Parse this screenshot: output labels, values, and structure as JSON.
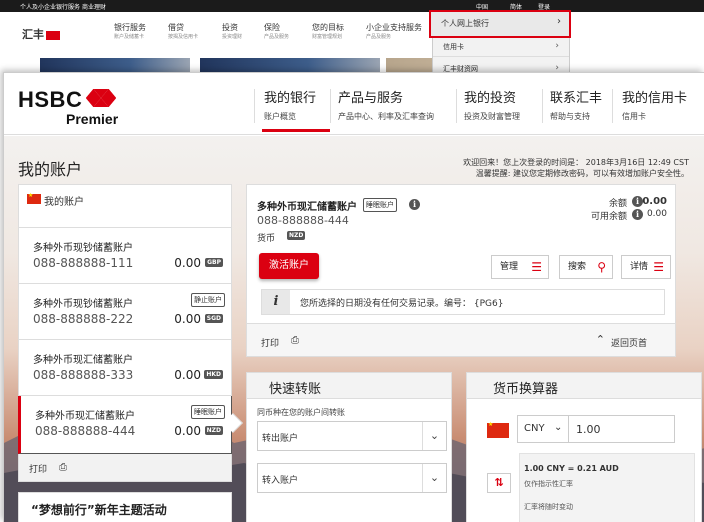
{
  "bg_site": {
    "top_links": [
      "个人及小企业银行服务",
      "商业理财"
    ],
    "top_right": [
      "中国",
      "简体",
      "登录"
    ],
    "logo_text": "汇丰",
    "nav": [
      {
        "title": "银行服务",
        "sub": "账户及储蓄卡"
      },
      {
        "title": "借贷",
        "sub": "按揭及信用卡"
      },
      {
        "title": "投资",
        "sub": "投资理财"
      },
      {
        "title": "保险",
        "sub": "产品及服务"
      },
      {
        "title": "您的目标",
        "sub": "财富管理规划"
      },
      {
        "title": "小企业支持服务",
        "sub": "产品及服务"
      }
    ],
    "dropdown": [
      "个人网上银行",
      "信用卡",
      "汇丰财资网"
    ]
  },
  "header": {
    "logo_word": "HSBC",
    "logo_sub": "Premier",
    "nav": [
      {
        "title": "我的银行",
        "sub": "账户概览"
      },
      {
        "title": "产品与服务",
        "sub": "产品中心、利率及汇率查询"
      },
      {
        "title": "我的投资",
        "sub": "投资及财富管理"
      },
      {
        "title": "联系汇丰",
        "sub": "帮助与支持"
      },
      {
        "title": "我的信用卡",
        "sub": "信用卡"
      }
    ]
  },
  "page": {
    "title": "我的账户",
    "welcome_line1": "欢迎回来！您上次登录的时间是： 2018年3月16日 12:49 CST",
    "welcome_line2": "温馨提醒: 建议您定期修改密码，可以有效增加账户安全性。"
  },
  "accounts_panel": {
    "header": "我的账户",
    "accounts": [
      {
        "name": "多种外币现钞储蓄账户",
        "number": "088-888888-111",
        "balance": "0.00",
        "currency": "GBP",
        "tag": ""
      },
      {
        "name": "多种外币现钞储蓄账户",
        "number": "088-888888-222",
        "balance": "0.00",
        "currency": "SGD",
        "tag": "静止账户"
      },
      {
        "name": "多种外币现汇储蓄账户",
        "number": "088-888888-333",
        "balance": "0.00",
        "currency": "HKD",
        "tag": ""
      },
      {
        "name": "多种外币现汇储蓄账户",
        "number": "088-888888-444",
        "balance": "0.00",
        "currency": "NZD",
        "tag": "睡眠账户"
      }
    ],
    "print": "打印",
    "promo": "“梦想前行”新年主题活动"
  },
  "detail": {
    "name": "多种外币现汇储蓄账户",
    "tag": "睡眠账户",
    "number": "088-888888-444",
    "currency_label": "货币",
    "currency": "NZD",
    "balance_label": "余额",
    "balance": "0.00",
    "available_label": "可用余额",
    "available": "0.00",
    "activate": "激活账户",
    "manage": "管理",
    "search": "搜索",
    "details": "详情",
    "message": "您所选择的日期没有任何交易记录。编号： {PG6}",
    "print": "打印",
    "back": "返回页首"
  },
  "transfer": {
    "title": "快速转账",
    "subtitle": "同币种在您的账户间转账",
    "from_placeholder": "转出账户",
    "to_placeholder": "转入账户"
  },
  "converter": {
    "title": "货币换算器",
    "currency": "CNY",
    "amount": "1.00",
    "rate": "1.00 CNY = 0.21 AUD",
    "note": "仅作指示性汇率",
    "note2": "汇率将随时变动"
  },
  "colors": {
    "brand_red": "#db0011"
  }
}
